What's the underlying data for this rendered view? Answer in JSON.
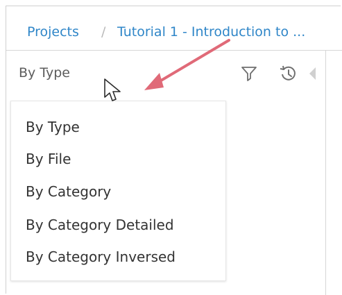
{
  "breadcrumb": {
    "projects_label": "Projects",
    "separator": "/",
    "current_label": "Tutorial 1 - Introduction to ..."
  },
  "left_panel": {
    "type_selector_label": "By Type"
  },
  "dropdown": {
    "items": [
      "By Type",
      "By File",
      "By Category",
      "By Category Detailed",
      "By Category Inversed"
    ]
  },
  "colors": {
    "link_blue": "#2f86c8",
    "annotation_arrow": "#e06a78",
    "border_gray": "#d6d6d6",
    "text_gray": "#5c5c5c"
  },
  "icons": {
    "filter": "filter-icon",
    "history": "history-icon",
    "collapse": "collapse-arrow-icon",
    "cursor": "mouse-pointer-icon"
  }
}
